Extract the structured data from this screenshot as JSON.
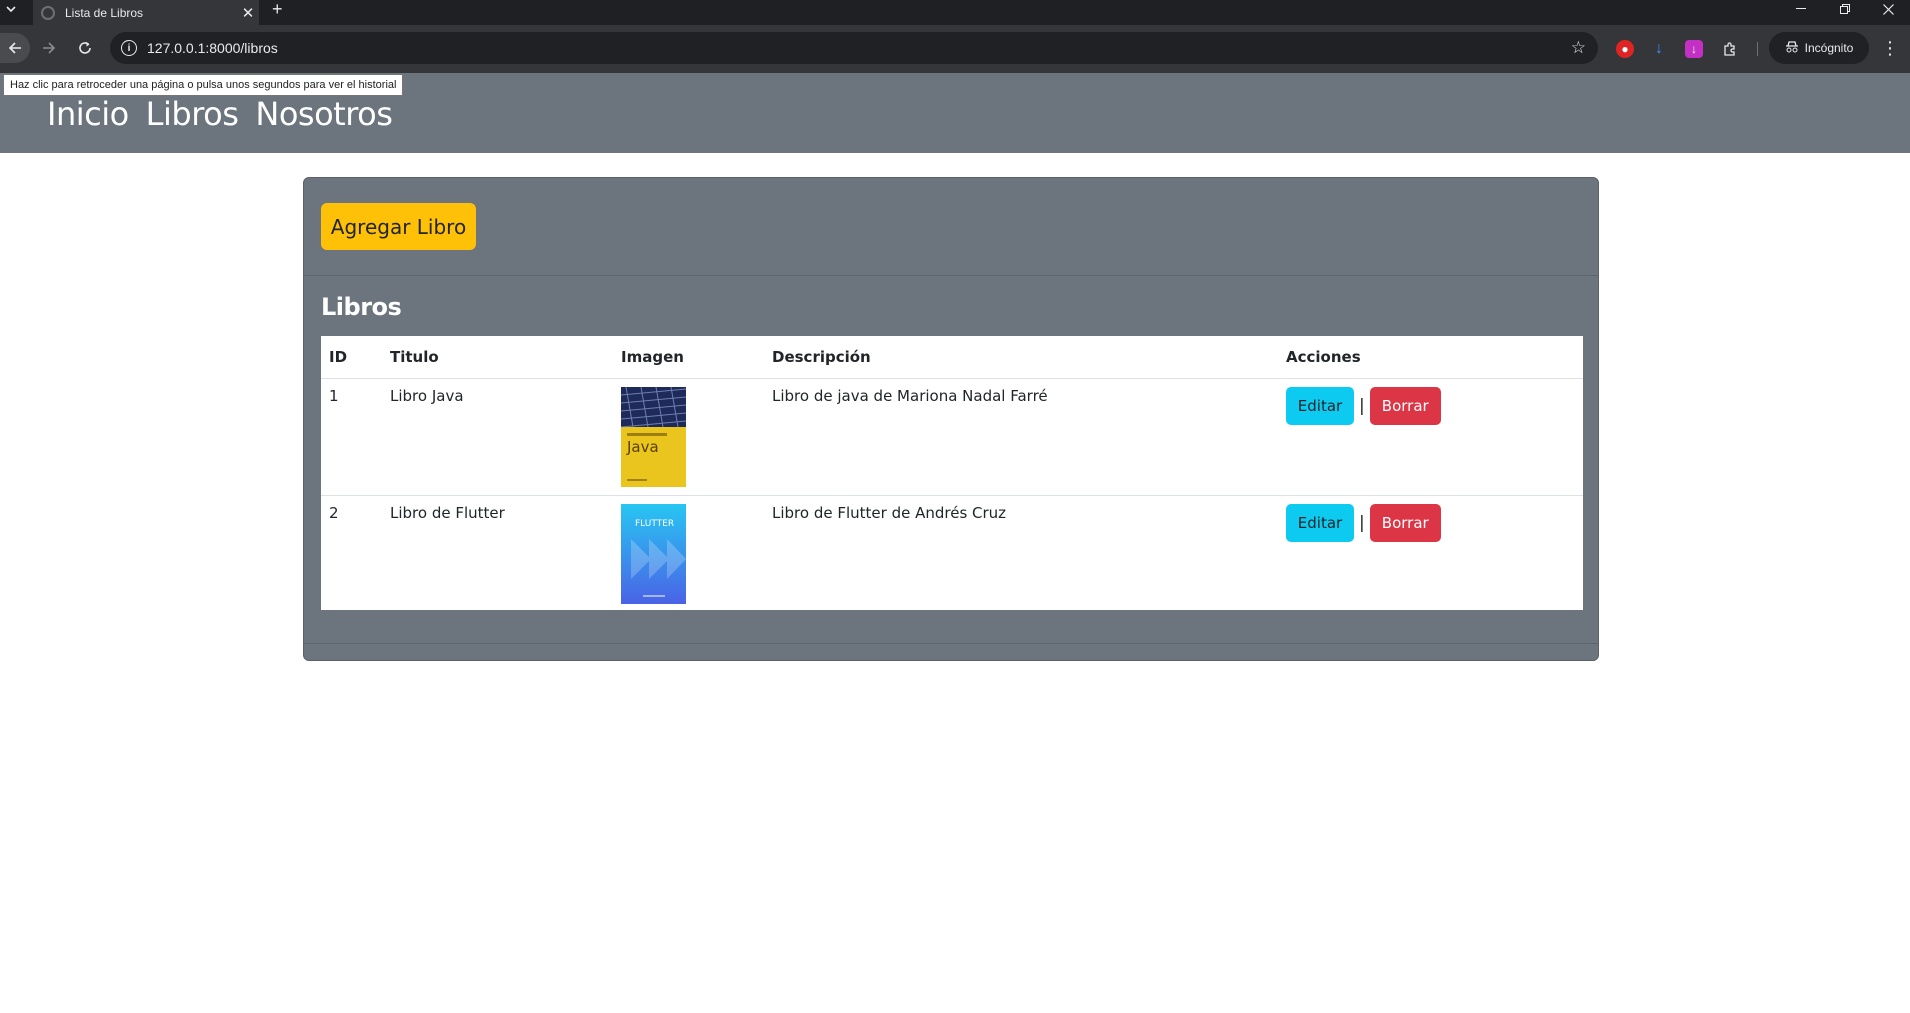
{
  "browser": {
    "tab_title": "Lista de Libros",
    "tab_close": "✕",
    "new_tab": "+",
    "url": "127.0.0.1:8000/libros",
    "profile_label": "Incógnito",
    "tooltip": "Haz clic para retroceder una página o pulsa unos segundos para ver el historial"
  },
  "nav": {
    "links": [
      "Inicio",
      "Libros",
      "Nosotros"
    ]
  },
  "card": {
    "add_button": "Agregar Libro",
    "title": "Libros",
    "columns": [
      "ID",
      "Titulo",
      "Imagen",
      "Descripción",
      "Acciones"
    ],
    "rows": [
      {
        "id": "1",
        "titulo": "Libro Java",
        "descripcion": "Libro de java de Mariona Nadal Farré",
        "cover_title": "Java",
        "cover_colors": [
          "#1e2a5a",
          "#e9c51d"
        ]
      },
      {
        "id": "2",
        "titulo": "Libro de Flutter",
        "descripcion": "Libro de Flutter de Andrés Cruz",
        "cover_title": "FLUTTER",
        "cover_colors": [
          "#22b8f0",
          "#3b6fe0"
        ]
      }
    ],
    "edit_label": "Editar",
    "delete_label": "Borrar",
    "separator": "|"
  },
  "colors": {
    "nav_bg": "#6c757d",
    "warning": "#ffc107",
    "info": "#0dcaf0",
    "danger": "#dc3545"
  }
}
